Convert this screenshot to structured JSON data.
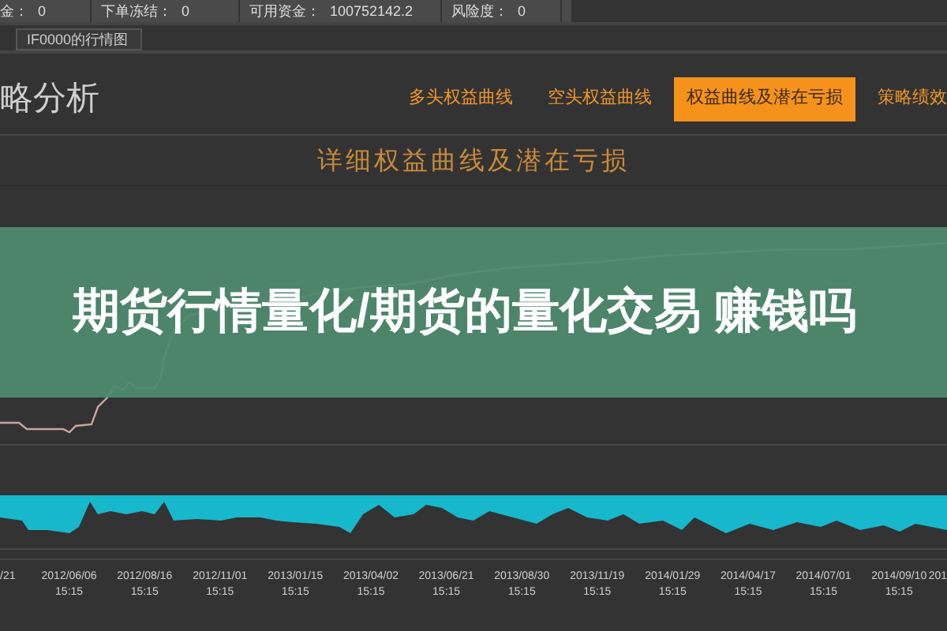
{
  "account_bar": [
    {
      "label": "金：",
      "value": "0"
    },
    {
      "label": "下单冻结：",
      "value": "0"
    },
    {
      "label": "可用资金：",
      "value": "100752142.2"
    },
    {
      "label": "风险度：",
      "value": "0"
    }
  ],
  "doc_tabs": [
    {
      "label": "IF0000的行情图",
      "selected": true
    }
  ],
  "page_title": "略分析",
  "tabs": [
    {
      "label": "多头权益曲线",
      "selected": false
    },
    {
      "label": "空头权益曲线",
      "selected": false
    },
    {
      "label": "权益曲线及潜在亏损",
      "selected": true
    },
    {
      "label": "策略绩效",
      "selected": false
    }
  ],
  "chart_title": "详细权益曲线及潜在亏损",
  "x_labels": [
    {
      "date": "/21"
    },
    {
      "date": "2012/06/06",
      "time": "15:15"
    },
    {
      "date": "2012/08/16",
      "time": "15:15"
    },
    {
      "date": "2012/11/01",
      "time": "15:15"
    },
    {
      "date": "2013/01/15",
      "time": "15:15"
    },
    {
      "date": "2013/04/02",
      "time": "15:15"
    },
    {
      "date": "2013/06/21",
      "time": "15:15"
    },
    {
      "date": "2013/08/30",
      "time": "15:15"
    },
    {
      "date": "2013/11/19",
      "time": "15:15"
    },
    {
      "date": "2014/01/29",
      "time": "15:15"
    },
    {
      "date": "2014/04/17",
      "time": "15:15"
    },
    {
      "date": "2014/07/01",
      "time": "15:15"
    },
    {
      "date": "2014/09/10",
      "time": "15:15"
    },
    {
      "date": "201"
    }
  ],
  "banner": {
    "title": "期货行情量化/期货的量化交易 赚钱吗"
  }
}
